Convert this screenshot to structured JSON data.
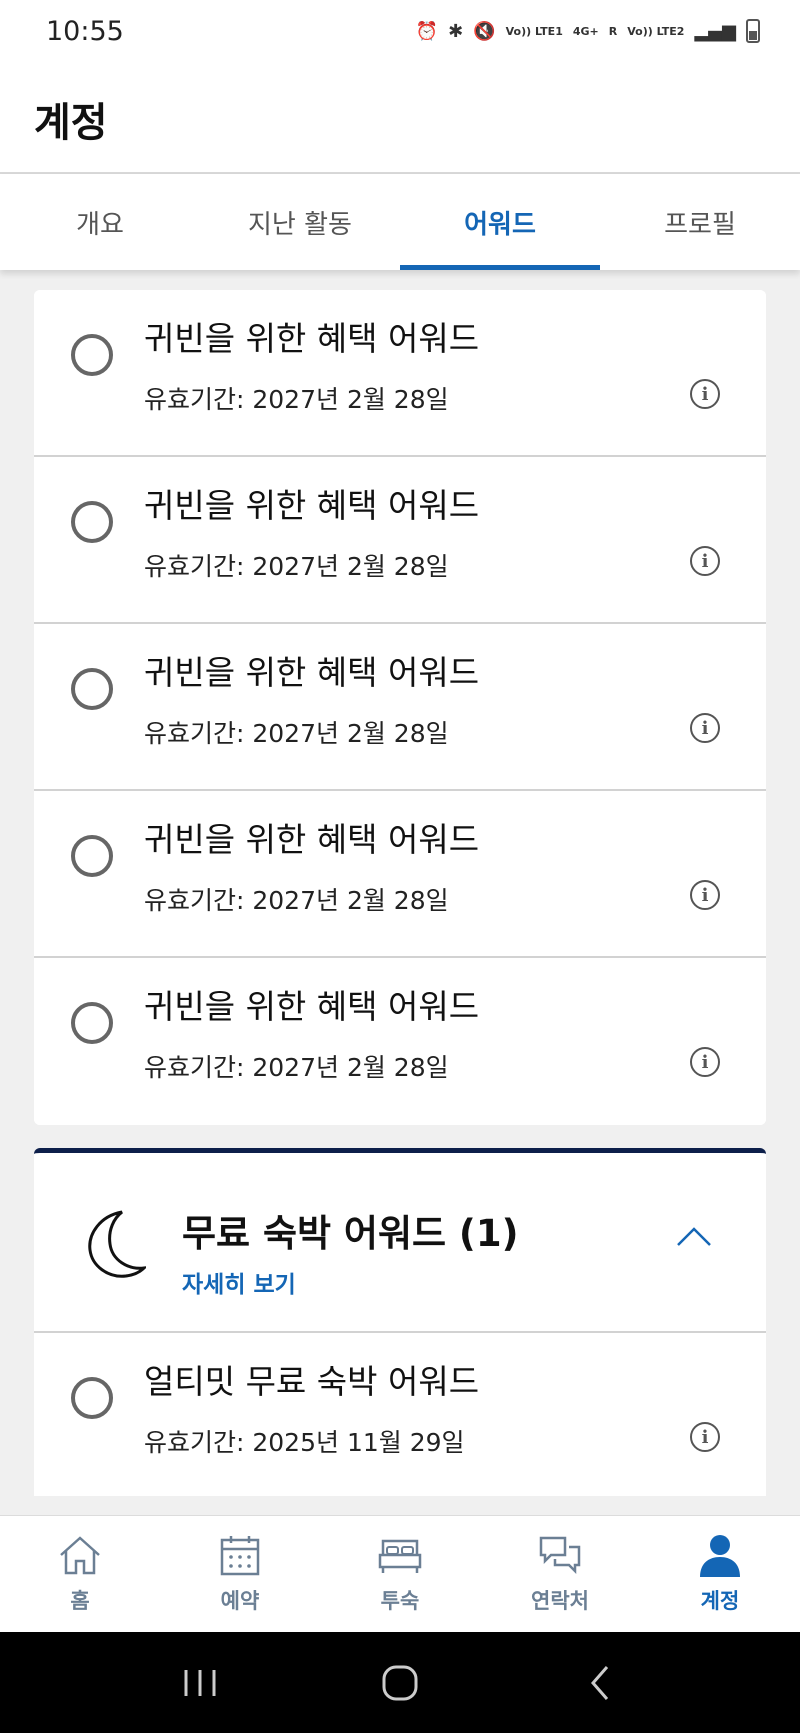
{
  "status_bar": {
    "time": "10:55",
    "sim1": "Vo)) LTE1",
    "net": "4G+",
    "roam": "R",
    "sim2": "Vo)) LTE2"
  },
  "header": {
    "title": "계정"
  },
  "tabs": [
    {
      "label": "개요",
      "active": false
    },
    {
      "label": "지난 활동",
      "active": false
    },
    {
      "label": "어워드",
      "active": true
    },
    {
      "label": "프로필",
      "active": false
    }
  ],
  "awards": [
    {
      "name": "귀빈을 위한 혜택 어워드",
      "expiry": "유효기간: 2027년 2월 28일"
    },
    {
      "name": "귀빈을 위한 혜택 어워드",
      "expiry": "유효기간: 2027년 2월 28일"
    },
    {
      "name": "귀빈을 위한 혜택 어워드",
      "expiry": "유효기간: 2027년 2월 28일"
    },
    {
      "name": "귀빈을 위한 혜택 어워드",
      "expiry": "유효기간: 2027년 2월 28일"
    },
    {
      "name": "귀빈을 위한 혜택 어워드",
      "expiry": "유효기간: 2027년 2월 28일"
    }
  ],
  "free_night": {
    "title": "무료 숙박 어워드 (1)",
    "details_link": "자세히 보기",
    "item": {
      "name": "얼티밋 무료 숙박 어워드",
      "expiry": "유효기간: 2025년 11월 29일"
    }
  },
  "bottom_nav": [
    {
      "label": "홈",
      "icon": "home-icon"
    },
    {
      "label": "예약",
      "icon": "calendar-icon"
    },
    {
      "label": "투숙",
      "icon": "bed-icon"
    },
    {
      "label": "연락처",
      "icon": "chat-icon"
    },
    {
      "label": "계정",
      "icon": "account-icon",
      "active": true
    }
  ],
  "colors": {
    "accent": "#1466b5",
    "dark_navy": "#0d1f4a",
    "nav_inactive": "#6b7f94"
  }
}
